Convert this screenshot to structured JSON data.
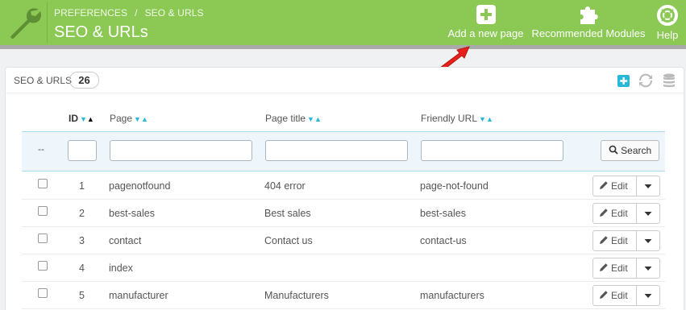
{
  "header": {
    "breadcrumb": [
      "PREFERENCES",
      "SEO & URLS"
    ],
    "breadcrumb_separator": "/",
    "title": "SEO & URLs",
    "toolbar": {
      "add_label": "Add a new page",
      "recommended_label": "Recommended Modules",
      "help_label": "Help"
    },
    "color": "#8bc954"
  },
  "panel": {
    "title": "SEO & URLS",
    "count": "26",
    "icons": [
      "add-new-icon",
      "refresh-icon",
      "sql-database-icon"
    ]
  },
  "table": {
    "columns": {
      "id": "ID",
      "page": "Page",
      "page_title": "Page title",
      "friendly_url": "Friendly URL"
    },
    "filter_placeholder": "--",
    "search_label": "Search",
    "edit_label": "Edit",
    "rows": [
      {
        "id": "1",
        "page": "pagenotfound",
        "title": "404 error",
        "url": "page-not-found"
      },
      {
        "id": "2",
        "page": "best-sales",
        "title": "Best sales",
        "url": "best-sales"
      },
      {
        "id": "3",
        "page": "contact",
        "title": "Contact us",
        "url": "contact-us"
      },
      {
        "id": "4",
        "page": "index",
        "title": "",
        "url": ""
      },
      {
        "id": "5",
        "page": "manufacturer",
        "title": "Manufacturers",
        "url": "manufacturers"
      }
    ]
  },
  "colors": {
    "accent": "#25b9d7",
    "arrow": "#e8201b"
  }
}
